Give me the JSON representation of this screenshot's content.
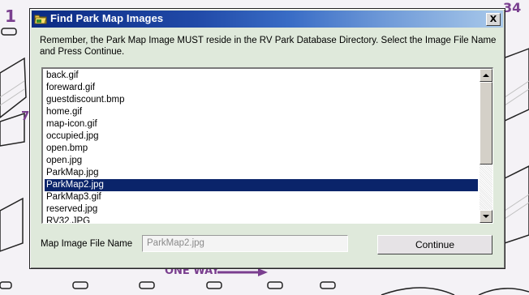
{
  "dialog": {
    "title": "Find Park Map Images",
    "close_label": "X",
    "instructions": "Remember, the Park Map Image MUST reside in the RV Park Database Directory. Select the Image File Name and Press Continue.",
    "files": [
      "back.gif",
      "foreward.gif",
      "guestdiscount.bmp",
      "home.gif",
      "map-icon.gif",
      "occupied.jpg",
      "open.bmp",
      "open.jpg",
      "ParkMap.jpg",
      "ParkMap2.jpg",
      "ParkMap3.gif",
      "reserved.jpg",
      "RV32.JPG"
    ],
    "selected_file": "ParkMap2.jpg",
    "field_label": "Map Image File Name",
    "field_value": "ParkMap2.jpg",
    "continue_label": "Continue"
  },
  "background": {
    "site_1": "1",
    "site_34": "34",
    "site_7": "7",
    "one_way": "ONE WAY"
  }
}
